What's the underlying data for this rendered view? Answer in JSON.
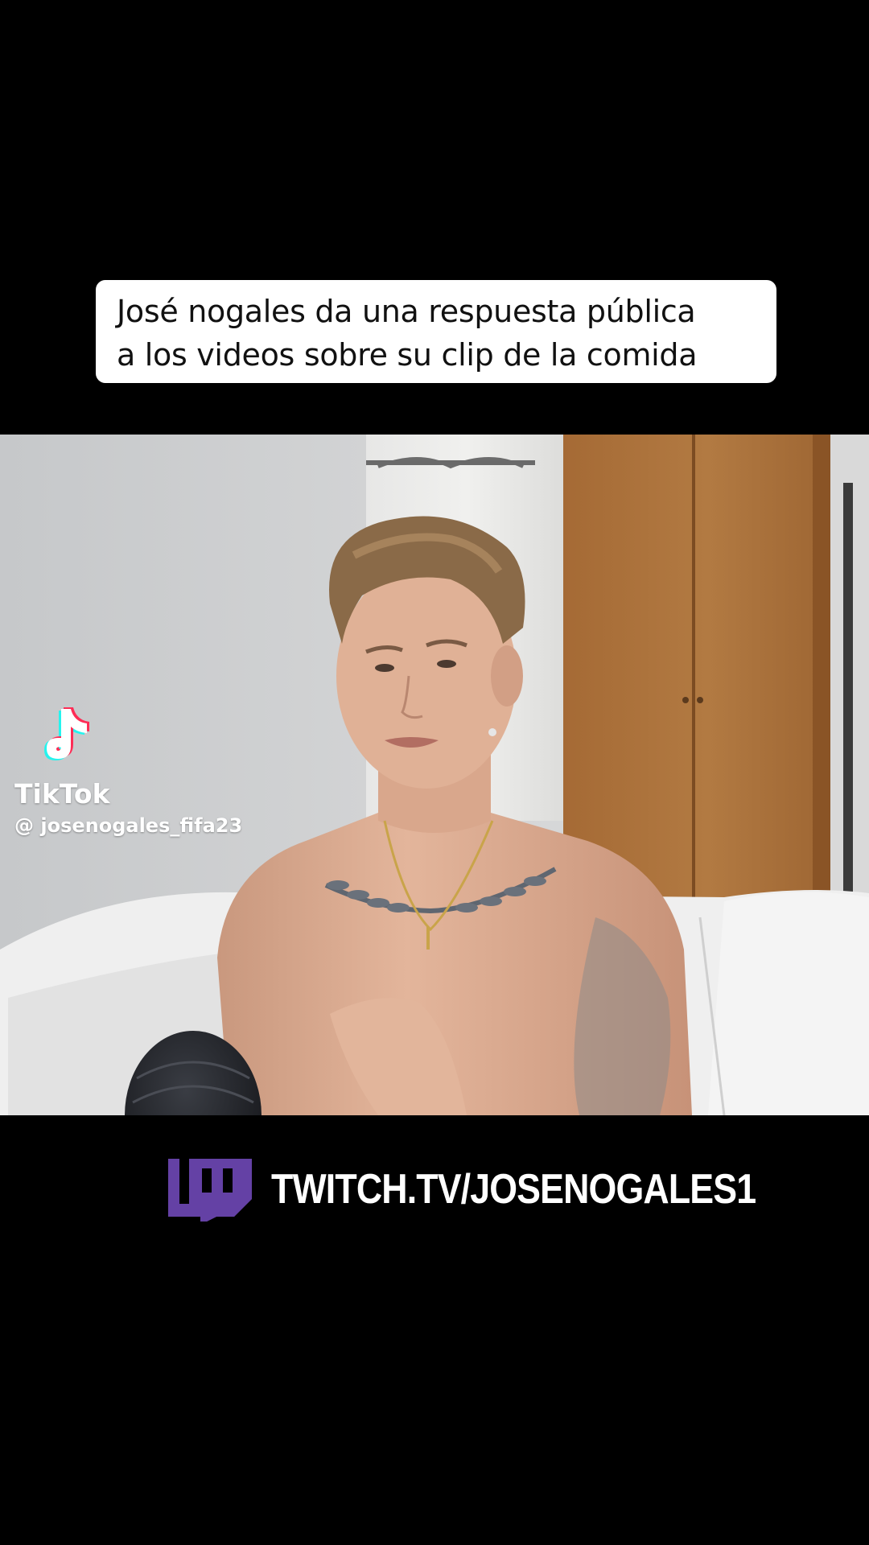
{
  "caption": {
    "line1": "José nogales da una respuesta pública",
    "line2": "a los videos sobre su clip de la comida"
  },
  "watermark": {
    "brand": "TikTok",
    "handle": "@ josenogales_fifa23",
    "icon": "tiktok-logo-icon"
  },
  "banner": {
    "icon": "twitch-logo-icon",
    "url_text": "TWITCH.TV/JOSENOGALES1",
    "accent_color": "#6441a5"
  },
  "colors": {
    "background": "#000000",
    "caption_bg": "#ffffff",
    "caption_text": "#111111"
  }
}
